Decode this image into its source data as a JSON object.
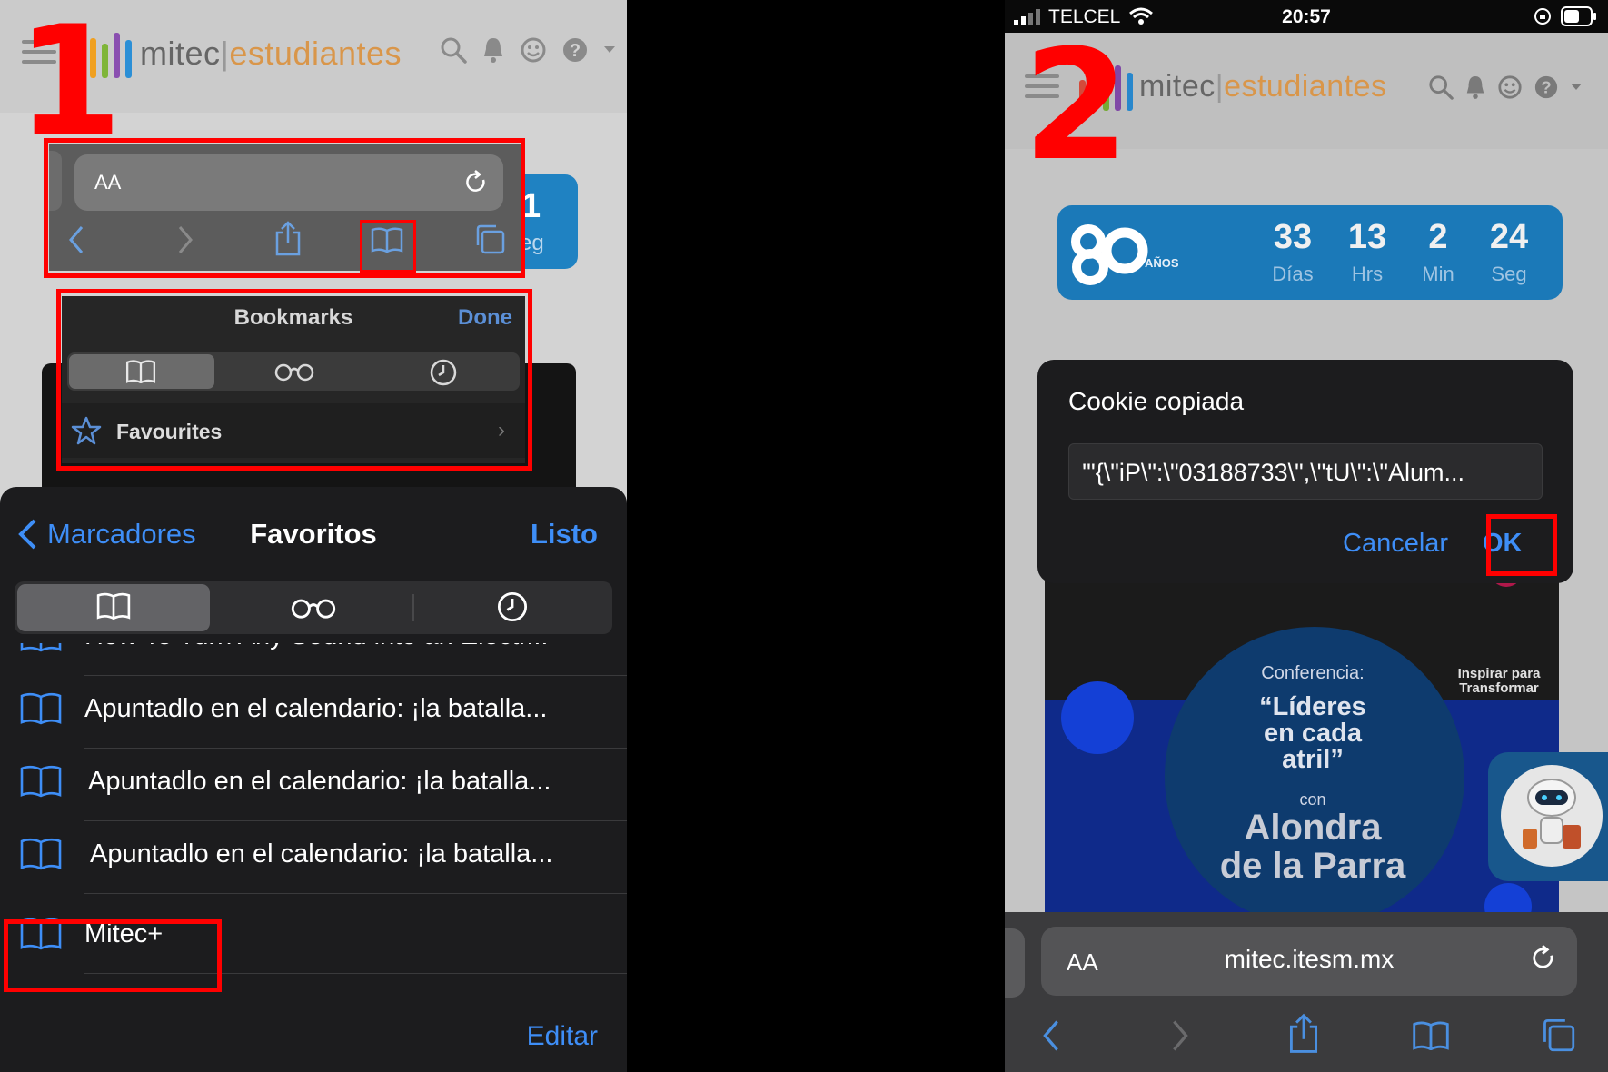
{
  "panel1": {
    "step_label": "1",
    "header": {
      "logo_text": "mitec",
      "logo_separator": "|",
      "logo_sub": "estudiantes"
    },
    "countdown_partial": {
      "value": "1",
      "label": "eg"
    },
    "safari_bar": {
      "text_size_label": "AA"
    },
    "bookmarks_popup": {
      "title": "Bookmarks",
      "done_label": "Done",
      "favourites_label": "Favourites"
    },
    "sheet": {
      "back_label": "Marcadores",
      "title": "Favoritos",
      "done_label": "Listo",
      "items": [
        {
          "label": "How To Turn Any Sound into an Electr..."
        },
        {
          "label": "Apuntadlo en el calendario: ¡la batalla..."
        },
        {
          "label": "Apuntadlo en el calendario: ¡la batalla..."
        },
        {
          "label": "Apuntadlo en el calendario: ¡la batalla..."
        },
        {
          "label": "Mitec+"
        }
      ],
      "edit_label": "Editar"
    }
  },
  "panel2": {
    "step_label": "2",
    "status": {
      "carrier": "TELCEL",
      "time": "20:57"
    },
    "header": {
      "logo_text": "mitec",
      "logo_separator": "|",
      "logo_sub": "estudiantes"
    },
    "countdown": {
      "badge_text": "AÑOS",
      "cells": [
        {
          "value": "33",
          "label": "Días"
        },
        {
          "value": "13",
          "label": "Hrs"
        },
        {
          "value": "2",
          "label": "Min"
        },
        {
          "value": "24",
          "label": "Seg"
        }
      ]
    },
    "alert": {
      "title": "Cookie copiada",
      "field_value": "'\"{\\\"iP\\\":\\\"03188733\\\",\\\"tU\\\":\\\"Alum...",
      "cancel_label": "Cancelar",
      "ok_label": "OK"
    },
    "poster": {
      "conference": "Conferencia:",
      "tagline": "Inspirar para Transformar",
      "title_line1": "“Líderes",
      "title_line2": "en cada",
      "title_line3": "atril”",
      "con": "con",
      "speaker_line1": "Alondra",
      "speaker_line2": "de la Parra"
    },
    "safari": {
      "text_size_label": "AA",
      "url": "mitec.itesm.mx"
    }
  },
  "colors": {
    "highlight_red": "#ff0000",
    "ios_blue": "#3e8ef7",
    "brand_blue": "#1b79b8",
    "logo_orange": "#d9964a"
  }
}
